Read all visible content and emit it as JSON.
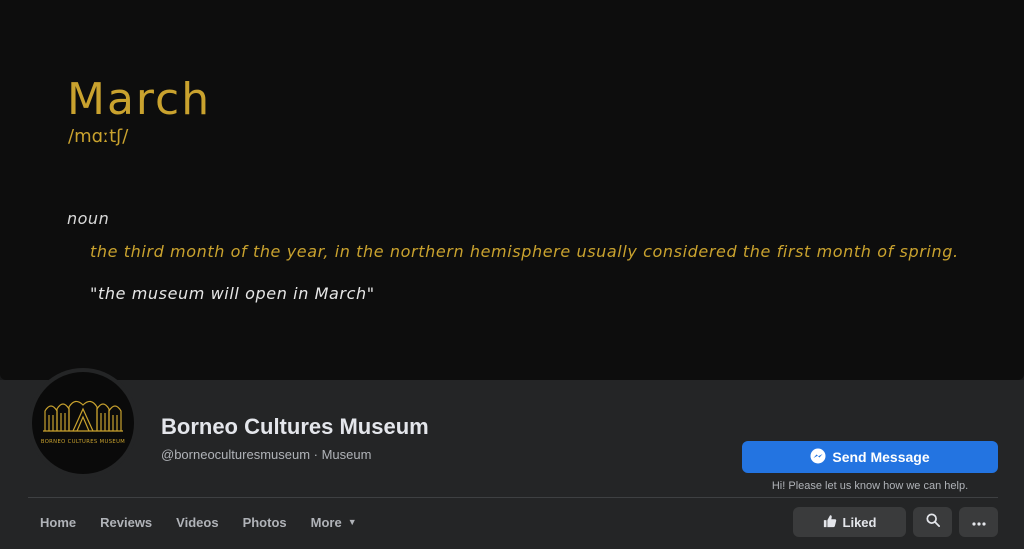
{
  "cover": {
    "word": "March",
    "pronunciation": "/mɑːtʃ/",
    "part_of_speech": "noun",
    "definition": "the third month of the year, in the northern hemisphere usually considered the first month of spring.",
    "example": "\"the museum will open in March\"",
    "colors": {
      "background": "#0d0d0d",
      "accent": "#c9a22e"
    }
  },
  "profile": {
    "avatar_text": "BORNEO CULTURES MUSEUM",
    "name": "Borneo Cultures Museum",
    "meta": "@borneoculturesmuseum · Museum"
  },
  "actions": {
    "send_message_label": "Send Message",
    "send_message_icon": "messenger-icon",
    "send_message_hint": "Hi! Please let us know how we can help.",
    "liked_label": "Liked",
    "liked_icon": "thumbs-up-icon",
    "search_icon": "search-icon",
    "more_icon": "ellipsis-icon"
  },
  "tabs": [
    {
      "label": "Home"
    },
    {
      "label": "Reviews"
    },
    {
      "label": "Videos"
    },
    {
      "label": "Photos"
    },
    {
      "label": "More",
      "icon": "caret-down-icon"
    }
  ],
  "theme": {
    "primary": "#2374e1",
    "surface": "#242526",
    "page": "#18191a"
  }
}
